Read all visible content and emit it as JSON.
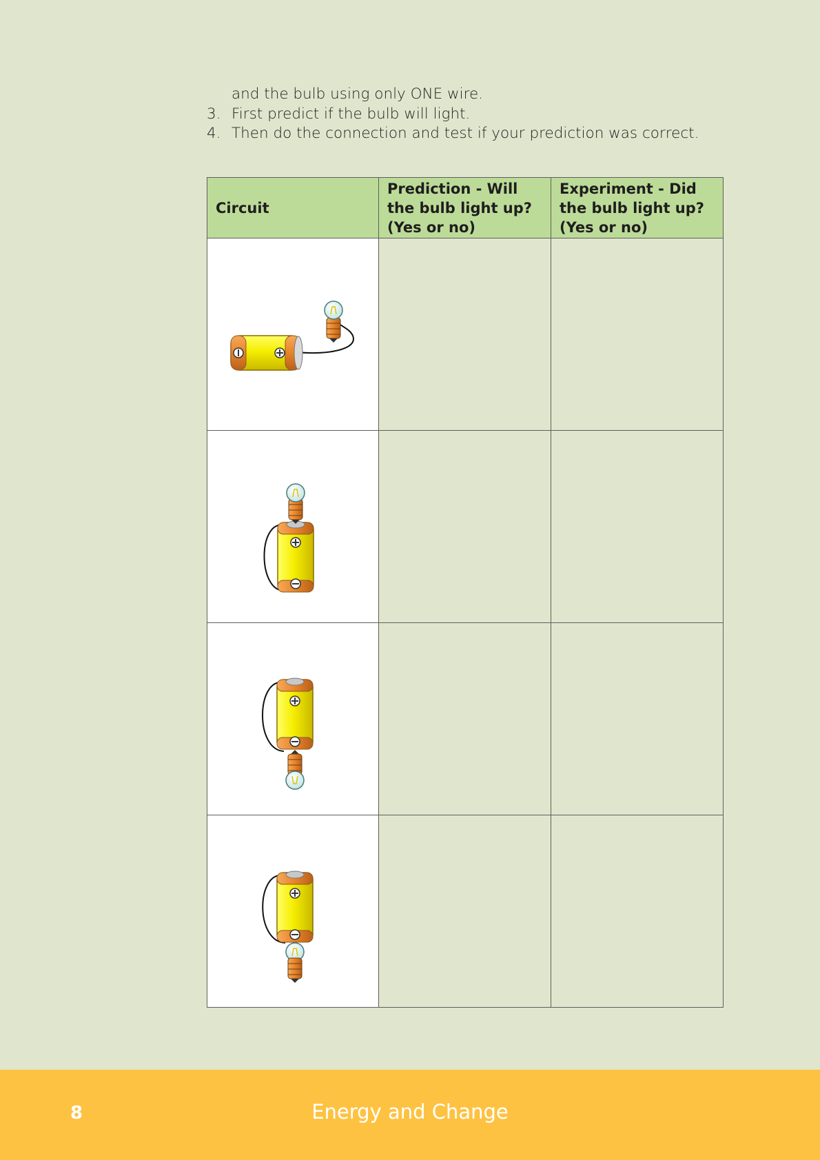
{
  "instructions": [
    {
      "num": "",
      "text": "and the bulb using only ONE wire."
    },
    {
      "num": "3.",
      "text": "First predict if the bulb will light."
    },
    {
      "num": "4.",
      "text": "Then do the connection and test if your prediction was correct."
    }
  ],
  "table": {
    "headers": [
      "Circuit",
      "Prediction - Will the bulb light up? (Yes or no)",
      "Experiment - Did the bulb light up? (Yes or no)"
    ],
    "rows": [
      {
        "circuit_icon": "battery-horizontal-bulb-wire-to-plus-end",
        "prediction": "",
        "experiment": ""
      },
      {
        "circuit_icon": "bulb-on-plus-end-wire-to-minus-end",
        "prediction": "",
        "experiment": ""
      },
      {
        "circuit_icon": "inverted-bulb-under-minus-end-wire-to-plus-end",
        "prediction": "",
        "experiment": ""
      },
      {
        "circuit_icon": "bulb-side-on-minus-end-wire-to-plus-end",
        "prediction": "",
        "experiment": ""
      }
    ]
  },
  "footer": {
    "page_number": "8",
    "title": "Energy and Change"
  },
  "colors": {
    "background": "#e0e6cd",
    "header_row": "#bddb98",
    "footer": "#fec242"
  }
}
